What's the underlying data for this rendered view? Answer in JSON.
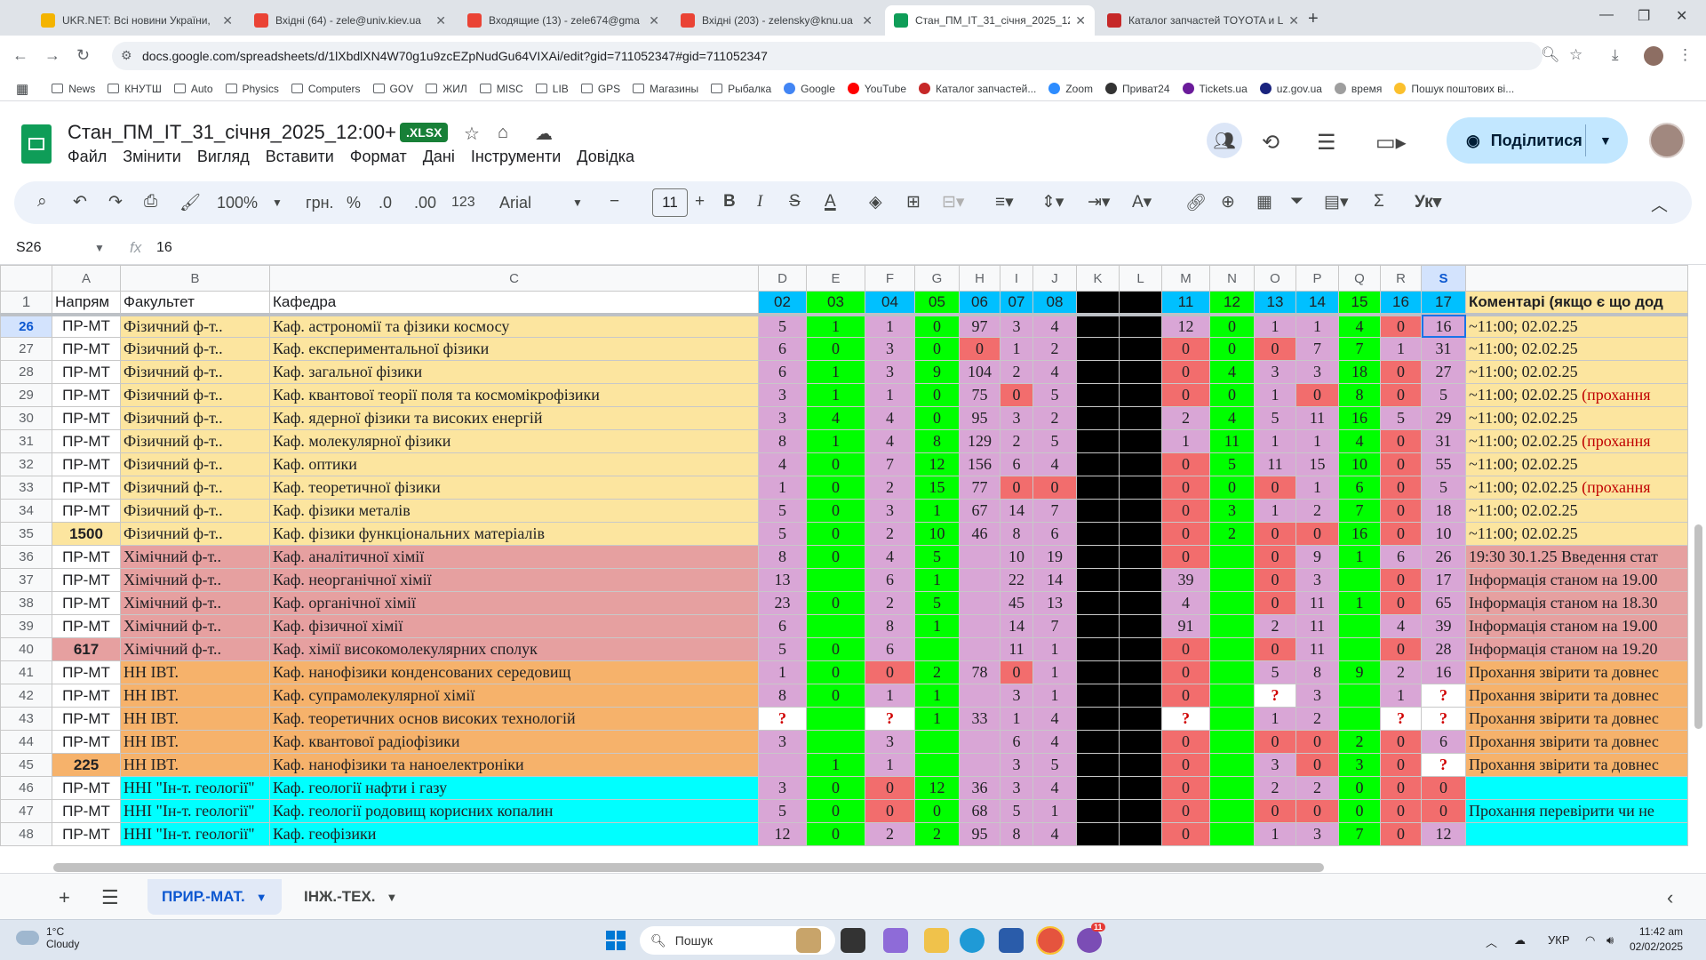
{
  "browser": {
    "tabs": [
      {
        "title": "UKR.NET: Всі новини України,",
        "favicon_color": "#f4b400"
      },
      {
        "title": "Вхідні (64) - zele@univ.kiev.ua",
        "favicon_color": "#ea4335"
      },
      {
        "title": "Входящие (13) - zele674@gma",
        "favicon_color": "#ea4335"
      },
      {
        "title": "Вхідні (203) - zelensky@knu.ua",
        "favicon_color": "#ea4335"
      },
      {
        "title": "Стан_ПМ_ІТ_31_січня_2025_12",
        "favicon_color": "#0f9d58",
        "active": true
      },
      {
        "title": "Каталог запчастей TOYOTA и L",
        "favicon_color": "#c62828"
      }
    ],
    "new_tab": "+",
    "url": "docs.google.com/spreadsheets/d/1lXbdlXN4W70g1u9zcEZpNudGu64VIXAi/edit?gid=711052347#gid=711052347",
    "bookmarks": [
      {
        "label": "",
        "type": "apps"
      },
      {
        "label": "News",
        "type": "folder"
      },
      {
        "label": "КНУТШ",
        "type": "folder"
      },
      {
        "label": "Auto",
        "type": "folder"
      },
      {
        "label": "Physics",
        "type": "folder"
      },
      {
        "label": "Computers",
        "type": "folder"
      },
      {
        "label": "GOV",
        "type": "folder"
      },
      {
        "label": "ЖИЛ",
        "type": "folder"
      },
      {
        "label": "MISC",
        "type": "folder"
      },
      {
        "label": "LIB",
        "type": "folder"
      },
      {
        "label": "GPS",
        "type": "folder"
      },
      {
        "label": "Магазины",
        "type": "folder"
      },
      {
        "label": "Рыбалка",
        "type": "folder"
      },
      {
        "label": "Google",
        "type": "site",
        "color": "#4285f4"
      },
      {
        "label": "YouTube",
        "type": "site",
        "color": "#ff0000"
      },
      {
        "label": "Каталог запчастей...",
        "type": "site",
        "color": "#c62828"
      },
      {
        "label": "Zoom",
        "type": "site",
        "color": "#2d8cff"
      },
      {
        "label": "Приват24",
        "type": "site",
        "color": "#333333"
      },
      {
        "label": "Tickets.ua",
        "type": "site",
        "color": "#6a1b9a"
      },
      {
        "label": "uz.gov.ua",
        "type": "site",
        "color": "#1a237e"
      },
      {
        "label": "время",
        "type": "site",
        "color": "#9e9e9e"
      },
      {
        "label": "Пошук поштових ві...",
        "type": "site",
        "color": "#fbc02d"
      }
    ]
  },
  "sheets": {
    "doc_title": "Стан_ПМ_ІТ_31_січня_2025_12:00+",
    "badge": ".XLSX",
    "menu": [
      "Файл",
      "Змінити",
      "Вигляд",
      "Вставити",
      "Формат",
      "Дані",
      "Інструменти",
      "Довідка"
    ],
    "share_label": "Поділитися",
    "toolbar": {
      "zoom": "100%",
      "currency": "грн.",
      "percent": "%",
      "dec_less": ".0",
      "dec_more": ".00",
      "format123": "123",
      "font": "Arial",
      "font_size": "11"
    },
    "name_box": "S26",
    "formula_value": "16",
    "columns": [
      "A",
      "B",
      "C",
      "D",
      "E",
      "F",
      "G",
      "H",
      "I",
      "J",
      "K",
      "L",
      "M",
      "N",
      "O",
      "P",
      "Q",
      "R",
      "S",
      ""
    ],
    "selected_column": "S",
    "header_row": {
      "rownum": "1",
      "napr": "Напрям",
      "fak": "Факультет",
      "kaf": "Кафедра",
      "cols": [
        "02",
        "03",
        "04",
        "05",
        "06",
        "07",
        "08",
        "",
        "",
        "11",
        "12",
        "13",
        "14",
        "15",
        "16",
        "17"
      ],
      "comment": "Коментарі (якщо є що дод"
    },
    "rows": [
      {
        "n": "26",
        "napr": "ПР-МТ",
        "fak": "Фізичний ф-т..",
        "kaf": "Каф. астрономії та фізики космосу",
        "v": [
          "5",
          "1",
          "1",
          "0",
          "97",
          "3",
          "4",
          "",
          "",
          "12",
          "0",
          "1",
          "1",
          "4",
          "0",
          "16"
        ],
        "c": "~11:00;  02.02.25",
        "comment_red": ""
      },
      {
        "n": "27",
        "napr": "ПР-МТ",
        "fak": "Фізичний ф-т..",
        "kaf": "Каф. експериментальної фізики",
        "v": [
          "6",
          "0",
          "3",
          "0",
          "0",
          "1",
          "2",
          "",
          "",
          "0",
          "0",
          "0",
          "7",
          "7",
          "1",
          "31"
        ],
        "c": "~11:00;  02.02.25",
        "comment_red": ""
      },
      {
        "n": "28",
        "napr": "ПР-МТ",
        "fak": "Фізичний ф-т..",
        "kaf": "Каф. загальної фізики",
        "v": [
          "6",
          "1",
          "3",
          "9",
          "104",
          "2",
          "4",
          "",
          "",
          "0",
          "4",
          "3",
          "3",
          "18",
          "0",
          "27"
        ],
        "c": "~11:00;  02.02.25",
        "comment_red": ""
      },
      {
        "n": "29",
        "napr": "ПР-МТ",
        "fak": "Фізичний ф-т..",
        "kaf": "Каф. квантової теорії поля та космомікрофізики",
        "v": [
          "3",
          "1",
          "1",
          "0",
          "75",
          "0",
          "5",
          "",
          "",
          "0",
          "0",
          "1",
          "0",
          "8",
          "0",
          "5"
        ],
        "c": "~11:00;  02.02.25 ",
        "comment_red": "(прохання"
      },
      {
        "n": "30",
        "napr": "ПР-МТ",
        "fak": "Фізичний ф-т..",
        "kaf": "Каф. ядерної фізики та високих енергій",
        "v": [
          "3",
          "4",
          "4",
          "0",
          "95",
          "3",
          "2",
          "",
          "",
          "2",
          "4",
          "5",
          "11",
          "16",
          "5",
          "29"
        ],
        "c": "~11:00;  02.02.25",
        "comment_red": ""
      },
      {
        "n": "31",
        "napr": "ПР-МТ",
        "fak": "Фізичний ф-т..",
        "kaf": "Каф. молекулярної фізики",
        "v": [
          "8",
          "1",
          "4",
          "8",
          "129",
          "2",
          "5",
          "",
          "",
          "1",
          "11",
          "1",
          "1",
          "4",
          "0",
          "31"
        ],
        "c": "~11:00;  02.02.25 ",
        "comment_red": "(прохання"
      },
      {
        "n": "32",
        "napr": "ПР-МТ",
        "fak": "Фізичний ф-т..",
        "kaf": "Каф. оптики",
        "v": [
          "4",
          "0",
          "7",
          "12",
          "156",
          "6",
          "4",
          "",
          "",
          "0",
          "5",
          "11",
          "15",
          "10",
          "0",
          "55"
        ],
        "c": "~11:00;  02.02.25",
        "comment_red": ""
      },
      {
        "n": "33",
        "napr": "ПР-МТ",
        "fak": "Фізичний ф-т..",
        "kaf": "Каф. теоретичної фізики",
        "v": [
          "1",
          "0",
          "2",
          "15",
          "77",
          "0",
          "0",
          "",
          "",
          "0",
          "0",
          "0",
          "1",
          "6",
          "0",
          "5"
        ],
        "c": "~11:00;  02.02.25 ",
        "comment_red": "(прохання"
      },
      {
        "n": "34",
        "napr": "ПР-МТ",
        "fak": "Фізичний ф-т..",
        "kaf": "Каф. фізики металів",
        "v": [
          "5",
          "0",
          "3",
          "1",
          "67",
          "14",
          "7",
          "",
          "",
          "0",
          "3",
          "1",
          "2",
          "7",
          "0",
          "18"
        ],
        "c": "~11:00;  02.02.25",
        "comment_red": ""
      },
      {
        "n": "35",
        "napr": "1500",
        "fak": "Фізичний ф-т..",
        "kaf": "Каф. фізики функціональних матеріалів",
        "v": [
          "5",
          "0",
          "2",
          "10",
          "46",
          "8",
          "6",
          "",
          "",
          "0",
          "2",
          "0",
          "0",
          "16",
          "0",
          "10"
        ],
        "c": "~11:00;  02.02.25",
        "comment_red": ""
      },
      {
        "n": "36",
        "napr": "ПР-МТ",
        "fak": "Хімічний ф-т..",
        "kaf": "Каф. аналітичної хімії",
        "v": [
          "8",
          "0",
          "4",
          "5",
          "",
          "10",
          "19",
          "",
          "",
          "0",
          "",
          "0",
          "9",
          "1",
          "6",
          "26"
        ],
        "c": "19:30 30.1.25 Введення стат",
        "comment_red": ""
      },
      {
        "n": "37",
        "napr": "ПР-МТ",
        "fak": "Хімічний ф-т..",
        "kaf": "Каф. неорганічної хімії",
        "v": [
          "13",
          "",
          "6",
          "1",
          "",
          "22",
          "14",
          "",
          "",
          "39",
          "",
          "0",
          "3",
          "",
          "0",
          "17"
        ],
        "c": "Інформація станом на 19.00",
        "comment_red": ""
      },
      {
        "n": "38",
        "napr": "ПР-МТ",
        "fak": "Хімічний ф-т..",
        "kaf": "Каф. органічної хімії",
        "v": [
          "23",
          "0",
          "2",
          "5",
          "",
          "45",
          "13",
          "",
          "",
          "4",
          "",
          "0",
          "11",
          "1",
          "0",
          "65"
        ],
        "c": "Інформація станом на 18.30",
        "comment_red": ""
      },
      {
        "n": "39",
        "napr": "ПР-МТ",
        "fak": "Хімічний ф-т..",
        "kaf": "Каф. фізичної хімії",
        "v": [
          "6",
          "",
          "8",
          "1",
          "",
          "14",
          "7",
          "",
          "",
          "91",
          "",
          "2",
          "11",
          "",
          "4",
          "39"
        ],
        "c": "Інформація станом на 19.00",
        "comment_red": ""
      },
      {
        "n": "40",
        "napr": "617",
        "fak": "Хімічний ф-т..",
        "kaf": "Каф. хімії високомолекулярних сполук",
        "v": [
          "5",
          "0",
          "6",
          "",
          "",
          "11",
          "1",
          "",
          "",
          "0",
          "",
          "0",
          "11",
          "",
          "0",
          "28"
        ],
        "c": "Інформація станом на 19.20",
        "comment_red": ""
      },
      {
        "n": "41",
        "napr": "ПР-МТ",
        "fak": "НН ІВТ.",
        "kaf": "Каф. нанофізики конденсованих середовищ",
        "v": [
          "1",
          "0",
          "0",
          "2",
          "78",
          "0",
          "1",
          "",
          "",
          "0",
          "",
          "5",
          "8",
          "9",
          "2",
          "16"
        ],
        "c": "Прохання звірити та довнес",
        "comment_red": ""
      },
      {
        "n": "42",
        "napr": "ПР-МТ",
        "fak": "НН ІВТ.",
        "kaf": "Каф. супрамолекулярної хімії",
        "v": [
          "8",
          "0",
          "1",
          "1",
          "",
          "3",
          "1",
          "",
          "",
          "0",
          "",
          "?",
          "3",
          "",
          "1",
          "?"
        ],
        "c": "Прохання звірити та довнес",
        "comment_red": ""
      },
      {
        "n": "43",
        "napr": "ПР-МТ",
        "fak": "НН ІВТ.",
        "kaf": "Каф. теоретичних основ високих технологій",
        "v": [
          "?",
          "",
          "?",
          "1",
          "33",
          "1",
          "4",
          "",
          "",
          "?",
          "",
          "1",
          "2",
          "",
          "?",
          "?"
        ],
        "c": "Прохання звірити та довнес",
        "comment_red": ""
      },
      {
        "n": "44",
        "napr": "ПР-МТ",
        "fak": "НН ІВТ.",
        "kaf": "Каф. квантової радіофізики",
        "v": [
          "3",
          "",
          "3",
          "",
          "",
          "6",
          "4",
          "",
          "",
          "0",
          "",
          "0",
          "0",
          "2",
          "0",
          "6"
        ],
        "c": "Прохання звірити та довнес",
        "comment_red": ""
      },
      {
        "n": "45",
        "napr": "225",
        "fak": "НН ІВТ.",
        "kaf": "Каф. нанофізики та наноелектроніки",
        "v": [
          "",
          "1",
          "1",
          "",
          "",
          "3",
          "5",
          "",
          "",
          "0",
          "",
          "3",
          "0",
          "3",
          "0",
          "?"
        ],
        "c": "Прохання звірити та довнес",
        "comment_red": ""
      },
      {
        "n": "46",
        "napr": "ПР-МТ",
        "fak": "ННІ \"Ін-т. геології\"",
        "kaf": "Каф. геології нафти і газу",
        "v": [
          "3",
          "0",
          "0",
          "12",
          "36",
          "3",
          "4",
          "",
          "",
          "0",
          "",
          "2",
          "2",
          "0",
          "0",
          "0"
        ],
        "c": "",
        "comment_red": ""
      },
      {
        "n": "47",
        "napr": "ПР-МТ",
        "fak": "ННІ \"Ін-т. геології\"",
        "kaf": "Каф. геології родовищ корисних копалин",
        "v": [
          "5",
          "0",
          "0",
          "0",
          "68",
          "5",
          "1",
          "",
          "",
          "0",
          "",
          "0",
          "0",
          "0",
          "0",
          "0"
        ],
        "c": "Прохання перевірити чи не",
        "comment_red": ""
      },
      {
        "n": "48",
        "napr": "ПР-МТ",
        "fak": "ННІ \"Ін-т. геології\"",
        "kaf": "Каф. геофізики",
        "v": [
          "12",
          "0",
          "2",
          "2",
          "95",
          "8",
          "4",
          "",
          "",
          "0",
          "",
          "1",
          "3",
          "7",
          "0",
          "12"
        ],
        "c": "",
        "comment_red": ""
      }
    ],
    "sheet_tabs": [
      {
        "label": "ПРИР.-МАТ.",
        "active": true
      },
      {
        "label": "ІНЖ.-ТЕХ.",
        "active": false
      }
    ]
  },
  "taskbar": {
    "weather_temp": "1°C",
    "weather_desc": "Cloudy",
    "search_label": "Пошук",
    "lang": "УКР",
    "time": "11:42 am",
    "date": "02/02/2025",
    "badge_count": "11"
  },
  "colors": {
    "phys_bg": "#fce59f",
    "chem_bg": "#e6a0a0",
    "ivt_bg": "#f6b26b",
    "geo_bg": "#00ffff",
    "green": "#00ff00",
    "red": "#f26d6d",
    "pink": "#d9a6d6",
    "black": "#000000",
    "white": "#ffffff"
  }
}
